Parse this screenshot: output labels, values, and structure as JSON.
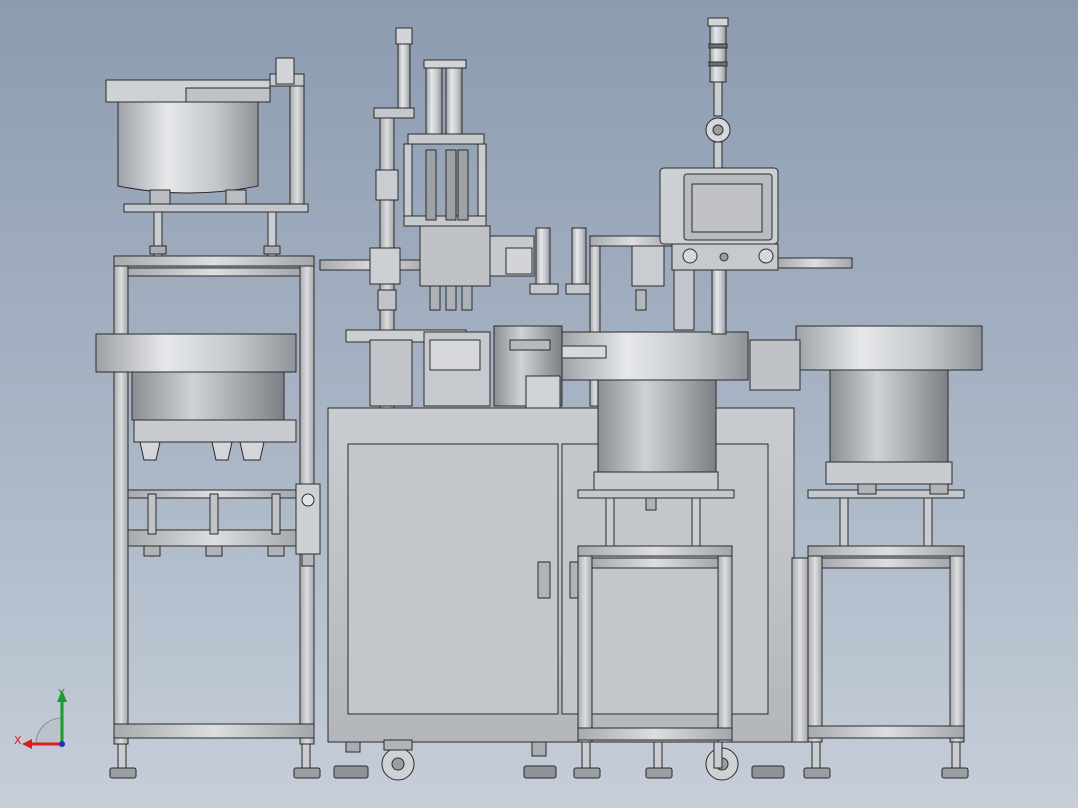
{
  "view_triad": {
    "x_label": "X",
    "y_label": "Y",
    "x_color": "#d8201c",
    "y_color": "#1c9a2a",
    "z_color": "#2030c0"
  },
  "colors": {
    "background_top": "#8c9bb0",
    "background_bottom": "#c6ced9",
    "metal_light": "#d9dbde",
    "metal_mid": "#b4b7bb",
    "metal_dark": "#8e9297",
    "edge": "#2b2b2b",
    "hmi_screen": "#c0c2c6"
  }
}
